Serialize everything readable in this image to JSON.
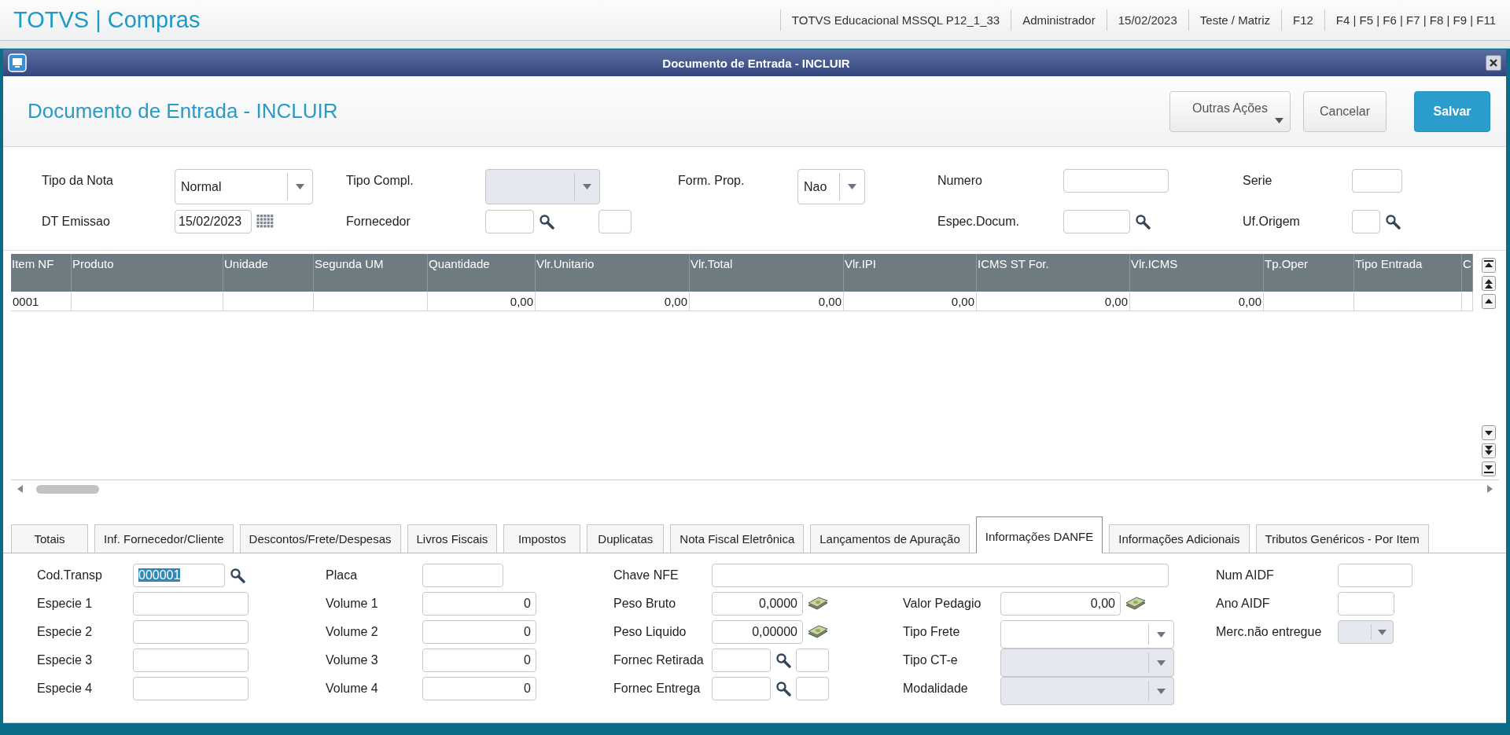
{
  "app": {
    "title": "TOTVS | Compras",
    "status_items": [
      "TOTVS Educacional MSSQL P12_1_33",
      "Administrador",
      "15/02/2023",
      "Teste / Matriz",
      "F12",
      "F4 | F5 | F6 | F7 | F8 | F9 | F11"
    ]
  },
  "window": {
    "title": "Documento de Entrada - INCLUIR"
  },
  "page": {
    "title": "Documento de Entrada - INCLUIR",
    "buttons": [
      {
        "label": "Outras Ações",
        "kind": "menu"
      },
      {
        "label": "Cancelar",
        "kind": "default"
      },
      {
        "label": "Salvar",
        "kind": "primary"
      }
    ]
  },
  "form": {
    "columns": [
      [
        {
          "label": "Tipo da Nota",
          "kind": "select",
          "value": "Normal",
          "disabled": false
        },
        {
          "label": "DT Emissao",
          "kind": "date",
          "value": "15/02/2023"
        }
      ],
      [
        {
          "label": "Tipo Compl.",
          "kind": "select",
          "disabled": true
        },
        {
          "label": "Fornecedor",
          "kind": "lookup-pair"
        }
      ],
      [
        {
          "label": "Form. Prop.",
          "kind": "select",
          "value": "Nao",
          "disabled": false
        }
      ],
      [
        {
          "label": "Numero",
          "kind": "text"
        },
        {
          "label": "Espec.Docum.",
          "kind": "lookup"
        }
      ],
      [
        {
          "label": "Serie",
          "kind": "text"
        },
        {
          "label": "Uf.Origem",
          "kind": "lookup"
        }
      ]
    ]
  },
  "items_grid": {
    "columns": [
      {
        "label": "Item NF",
        "kind": "text"
      },
      {
        "label": "Produto",
        "kind": "text"
      },
      {
        "label": "Unidade",
        "kind": "text"
      },
      {
        "label": "Segunda UM",
        "kind": "text"
      },
      {
        "label": "Quantidade",
        "kind": "number"
      },
      {
        "label": "Vlr.Unitario",
        "kind": "number"
      },
      {
        "label": "Vlr.Total",
        "kind": "number"
      },
      {
        "label": "Vlr.IPI",
        "kind": "number"
      },
      {
        "label": "ICMS ST For.",
        "kind": "number"
      },
      {
        "label": "Vlr.ICMS",
        "kind": "number"
      },
      {
        "label": "Tp.Oper",
        "kind": "text"
      },
      {
        "label": "Tipo Entrada",
        "kind": "text"
      },
      {
        "label": "C",
        "kind": "text"
      }
    ],
    "rows": [
      [
        "0001",
        null,
        null,
        null,
        "0,00",
        "0,00",
        "0,00",
        "0,00",
        "0,00",
        "0,00",
        null,
        null,
        null
      ]
    ]
  },
  "tabs": [
    {
      "label": "Totais",
      "selected": false
    },
    {
      "label": "Inf. Fornecedor/Cliente",
      "selected": false
    },
    {
      "label": "Descontos/Frete/Despesas",
      "selected": false
    },
    {
      "label": "Livros Fiscais",
      "selected": false
    },
    {
      "label": "Impostos",
      "selected": false
    },
    {
      "label": "Duplicatas",
      "selected": false
    },
    {
      "label": "Nota Fiscal Eletrônica",
      "selected": false
    },
    {
      "label": "Lançamentos de Apuração",
      "selected": false
    },
    {
      "label": "Informações DANFE",
      "selected": true
    },
    {
      "label": "Informações Adicionais",
      "selected": false
    },
    {
      "label": "Tributos Genéricos - Por Item",
      "selected": false
    }
  ],
  "danfe": {
    "columns": [
      [
        {
          "label": "Cod.Transp",
          "kind": "lookup",
          "value": "000001",
          "highlighted": true
        },
        {
          "label": "Especie 1",
          "kind": "text"
        },
        {
          "label": "Especie 2",
          "kind": "text"
        },
        {
          "label": "Especie 3",
          "kind": "text"
        },
        {
          "label": "Especie 4",
          "kind": "text"
        }
      ],
      [
        {
          "label": "Placa",
          "kind": "text"
        },
        {
          "label": "Volume 1",
          "kind": "number",
          "value": "0"
        },
        {
          "label": "Volume 2",
          "kind": "number",
          "value": "0"
        },
        {
          "label": "Volume 3",
          "kind": "number",
          "value": "0"
        },
        {
          "label": "Volume 4",
          "kind": "number",
          "value": "0"
        }
      ],
      [
        {
          "label": "Chave NFE",
          "kind": "text"
        },
        {
          "label": "Peso Bruto",
          "kind": "money",
          "value": "0,0000"
        },
        {
          "label": "Peso Liquido",
          "kind": "money",
          "value": "0,00000"
        },
        {
          "label": "Fornec Retirada",
          "kind": "lookup-pair"
        },
        {
          "label": "Fornec Entrega",
          "kind": "lookup-pair"
        }
      ],
      [
        {
          "label": "Valor Pedagio",
          "kind": "money",
          "value": "0,00"
        },
        {
          "label": "Tipo Frete",
          "kind": "select",
          "disabled": false
        },
        {
          "label": "Tipo CT-e",
          "kind": "select",
          "disabled": true
        },
        {
          "label": "Modalidade",
          "kind": "select",
          "disabled": true
        }
      ],
      [
        {
          "label": "Num AIDF",
          "kind": "text"
        },
        {
          "label": "Ano AIDF",
          "kind": "text"
        },
        {
          "label": "Merc.não entregue",
          "kind": "select",
          "disabled": true
        }
      ]
    ]
  }
}
